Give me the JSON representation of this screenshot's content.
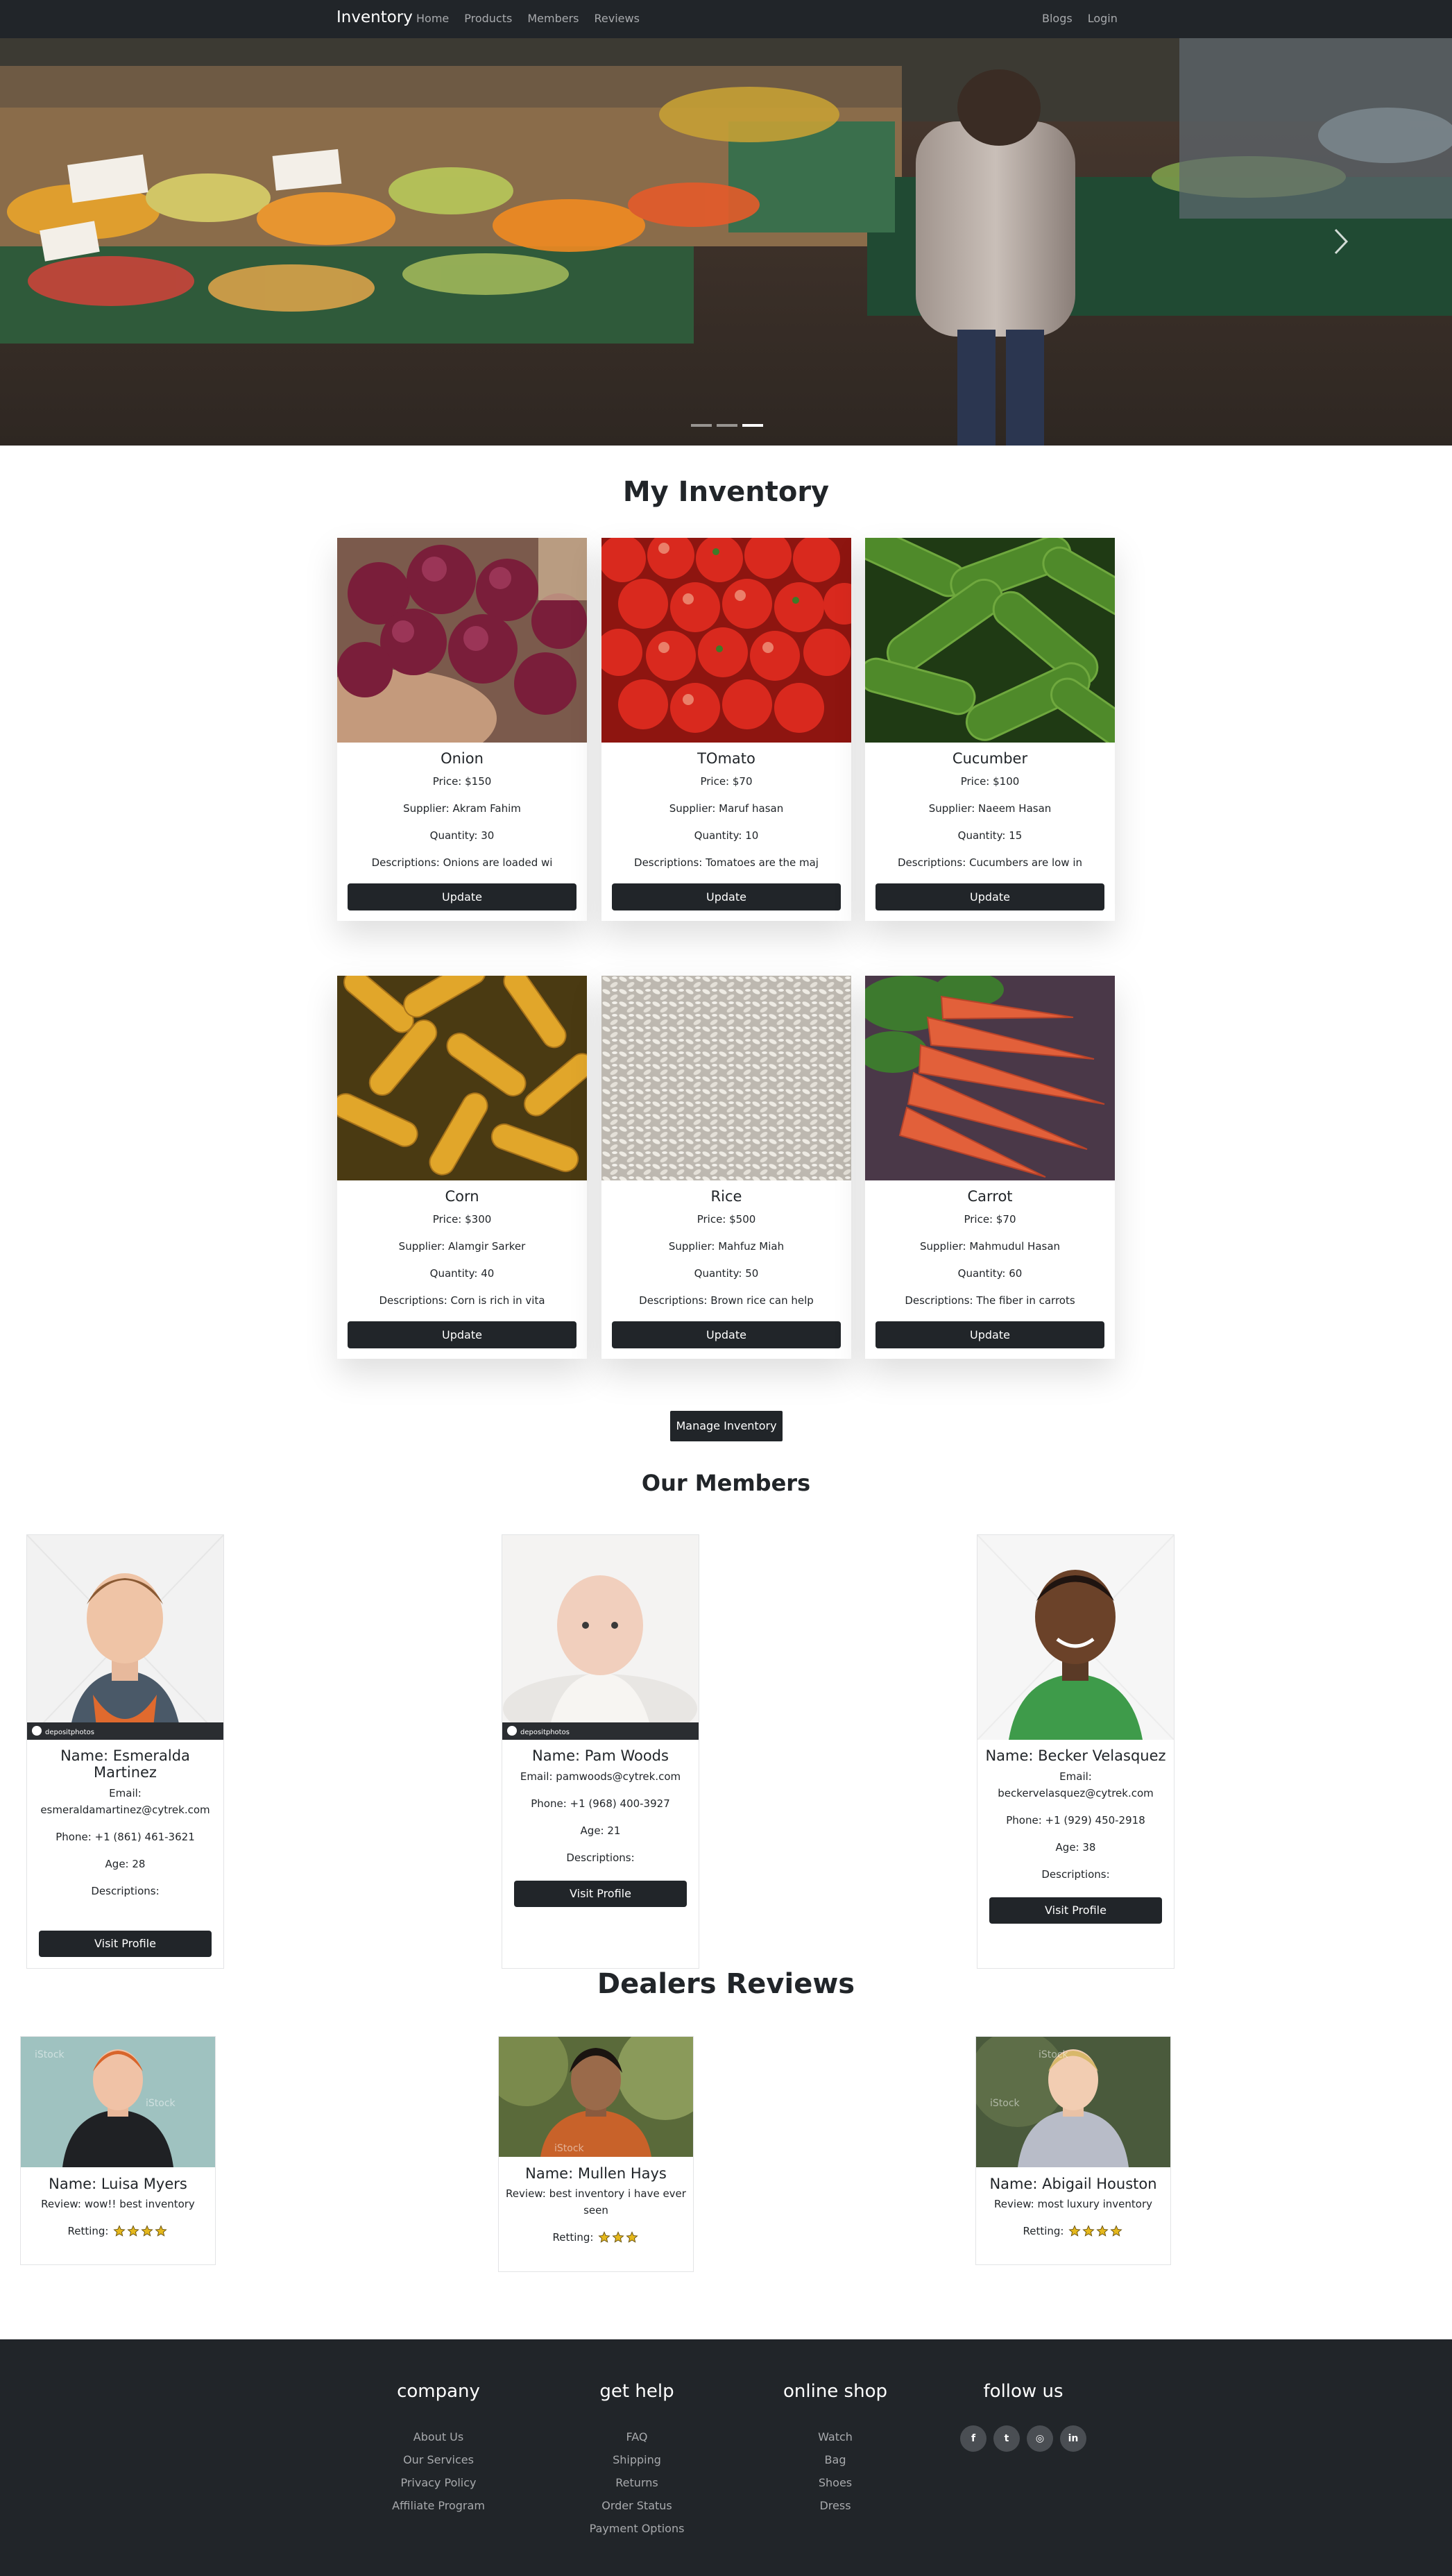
{
  "navbar": {
    "brand": "Inventory",
    "left_links": [
      "Home",
      "Products",
      "Members",
      "Reviews"
    ],
    "right_links": [
      "Blogs",
      "Login"
    ]
  },
  "hero": {
    "slide_count": 3,
    "active_slide": 3
  },
  "inventory": {
    "title": "My Inventory",
    "products": [
      {
        "name": "Onion",
        "price": "Price: $150",
        "supplier": "Supplier: Akram Fahim",
        "quantity": "Quantity: 30",
        "description": "Descriptions: Onions are loaded wi",
        "button": "Update",
        "image": "red-onions-photo"
      },
      {
        "name": "TOmato",
        "price": "Price: $70",
        "supplier": "Supplier: Maruf hasan",
        "quantity": "Quantity: 10",
        "description": "Descriptions: Tomatoes are the maj",
        "button": "Update",
        "image": "tomatoes-photo"
      },
      {
        "name": "Cucumber",
        "price": "Price: $100",
        "supplier": "Supplier: Naeem Hasan",
        "quantity": "Quantity: 15",
        "description": "Descriptions: Cucumbers are low in",
        "button": "Update",
        "image": "cucumbers-photo"
      },
      {
        "name": "Corn",
        "price": "Price: $300",
        "supplier": "Supplier: Alamgir Sarker",
        "quantity": "Quantity: 40",
        "description": "Descriptions: Corn is rich in vita",
        "button": "Update",
        "image": "corn-photo"
      },
      {
        "name": "Rice",
        "price": "Price: $500",
        "supplier": "Supplier: Mahfuz Miah",
        "quantity": "Quantity: 50",
        "description": "Descriptions: Brown rice can help",
        "button": "Update",
        "image": "rice-photo"
      },
      {
        "name": "Carrot",
        "price": "Price: $70",
        "supplier": "Supplier: Mahmudul Hasan",
        "quantity": "Quantity: 60",
        "description": "Descriptions: The fiber in carrots",
        "button": "Update",
        "image": "carrots-photo"
      }
    ],
    "manage_button": "Manage Inventory"
  },
  "members": {
    "title": "Our Members",
    "items": [
      {
        "name": "Name: Esmeralda Martinez",
        "email_label": "Email:",
        "email": "esmeraldamartinez@cytrek.com",
        "phone": "Phone: +1 (861) 461-3621",
        "age": "Age: 28",
        "descriptions": "Descriptions:",
        "button": "Visit Profile",
        "image_watermark": "depositphotos"
      },
      {
        "name": "Name: Pam Woods",
        "email_label": "Email:",
        "email": "pamwoods@cytrek.com",
        "phone": "Phone: +1 (968) 400-3927",
        "age": "Age: 21",
        "descriptions": "Descriptions:",
        "button": "Visit Profile",
        "image_watermark": "depositphotos"
      },
      {
        "name": "Name: Becker Velasquez",
        "email_label": "Email:",
        "email": "beckervelasquez@cytrek.com",
        "phone": "Phone: +1 (929) 450-2918",
        "age": "Age: 38",
        "descriptions": "Descriptions:",
        "button": "Visit Profile",
        "image_watermark": ""
      }
    ]
  },
  "reviews": {
    "title": "Dealers Reviews",
    "items": [
      {
        "name": "Name: Luisa Myers",
        "review": "Review: wow!! best inventory",
        "rating_label": "Retting:",
        "stars": 4,
        "image_watermark": "iStock"
      },
      {
        "name": "Name: Mullen Hays",
        "review": "Review: best inventory i have ever seen",
        "rating_label": "Retting:",
        "stars": 3,
        "image_watermark": "iStock"
      },
      {
        "name": "Name: Abigail Houston",
        "review": "Review: most luxury inventory",
        "rating_label": "Retting:",
        "stars": 4,
        "image_watermark": "iStock"
      }
    ]
  },
  "footer": {
    "columns": [
      {
        "heading": "company",
        "links": [
          "About Us",
          "Our Services",
          "Privacy Policy",
          "Affiliate Program"
        ]
      },
      {
        "heading": "get help",
        "links": [
          "FAQ",
          "Shipping",
          "Returns",
          "Order Status",
          "Payment Options"
        ]
      },
      {
        "heading": "online shop",
        "links": [
          "Watch",
          "Bag",
          "Shoes",
          "Dress"
        ]
      }
    ],
    "follow": {
      "heading": "follow us",
      "icons": [
        "facebook-icon",
        "twitter-icon",
        "instagram-icon",
        "linkedin-icon"
      ],
      "glyphs": [
        "f",
        "t",
        "◎",
        "in"
      ]
    }
  },
  "colors": {
    "dark": "#212529",
    "muted_text": "#a8aaad",
    "white": "#ffffff",
    "star": "#e5b81c"
  }
}
